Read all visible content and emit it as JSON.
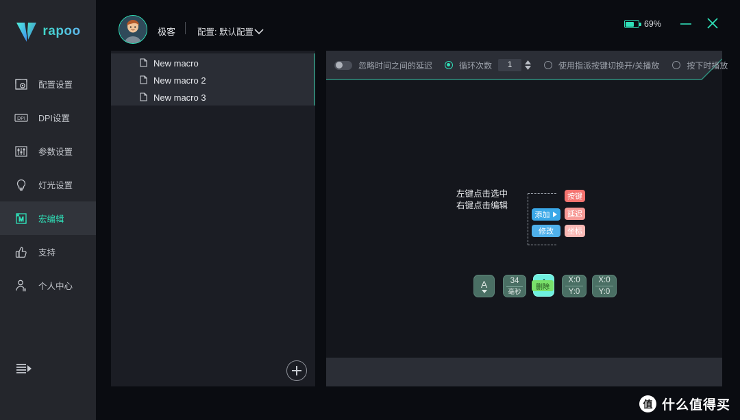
{
  "brand": {
    "name": "rapoo",
    "logo_icon": "rapoo-v-logo"
  },
  "sidebar": {
    "items": [
      {
        "label": "配置设置",
        "icon": "config-settings-icon",
        "active": false
      },
      {
        "label": "DPI设置",
        "icon": "dpi-settings-icon",
        "active": false
      },
      {
        "label": "参数设置",
        "icon": "parameter-settings-icon",
        "active": false
      },
      {
        "label": "灯光设置",
        "icon": "lighting-settings-icon",
        "active": false
      },
      {
        "label": "宏编辑",
        "icon": "macro-editor-icon",
        "active": true
      },
      {
        "label": "支持",
        "icon": "thumbs-up-icon",
        "active": false
      },
      {
        "label": "个人中心",
        "icon": "user-profile-icon",
        "active": false
      }
    ],
    "collapse_icon": "collapse-menu-icon"
  },
  "titlebar": {
    "avatar_icon": "user-avatar",
    "profile_name": "极客",
    "config_label": "配置: 默认配置",
    "config_caret_icon": "chevron-down-icon",
    "battery_label": "69%",
    "battery_icon": "battery-icon",
    "battery_percent": 69,
    "minimize_icon": "minimize-icon",
    "close_icon": "close-icon"
  },
  "macro_panel": {
    "items": [
      {
        "label": "New macro",
        "icon": "file-icon"
      },
      {
        "label": "New macro 2",
        "icon": "file-icon"
      },
      {
        "label": "New macro 3",
        "icon": "file-icon"
      }
    ],
    "add_button_icon": "plus-circle-icon"
  },
  "toolbar": {
    "ignore_delay_label": "忽略时间之间的延迟",
    "ignore_delay_on": false,
    "loop_count_label": "循环次数",
    "loop_count_selected": true,
    "loop_count_value": "1",
    "spinner_up_icon": "spinner-up-icon",
    "spinner_down_icon": "spinner-down-icon",
    "toggle_play_label": "使用指派按键切换开/关播放",
    "toggle_play_selected": false,
    "hold_play_label": "按下时播放",
    "hold_play_selected": false
  },
  "diagram": {
    "hint_line1": "左键点击选中",
    "hint_line2": "右键点击编辑",
    "menu": {
      "add_label": "添加",
      "add_arrow_icon": "caret-right-icon",
      "modify_label": "修改",
      "key_label": "按键",
      "delay_label": "延迟",
      "coord_label": "坐标"
    },
    "nodes": [
      {
        "type": "key",
        "key": "A",
        "direction": "down",
        "direction_icon": "arrow-down-icon",
        "highlighted": false
      },
      {
        "type": "delay",
        "value": "34",
        "unit": "毫秒",
        "highlighted": false
      },
      {
        "type": "key",
        "key": "A",
        "direction": "up",
        "direction_icon": "arrow-up-icon",
        "highlighted": true
      },
      {
        "type": "coord",
        "x": "X:0",
        "y": "Y:0",
        "highlighted": false
      },
      {
        "type": "coord",
        "x": "X:0",
        "y": "Y:0",
        "highlighted": false
      }
    ],
    "delete_label": "删除"
  },
  "watermark": {
    "logo_char": "值",
    "text": "什么值得买"
  },
  "colors": {
    "accent": "#2fe0b8",
    "sidebar_bg": "#24262c",
    "panel_bg": "#1b1d24",
    "editor_bg": "#14161c",
    "blue_pill": "#3aa8e8",
    "red_pill": "#f4736f",
    "node_green": "#4a6f64",
    "node_highlight": "#6ff0df",
    "delete_green": "#79e06a"
  }
}
